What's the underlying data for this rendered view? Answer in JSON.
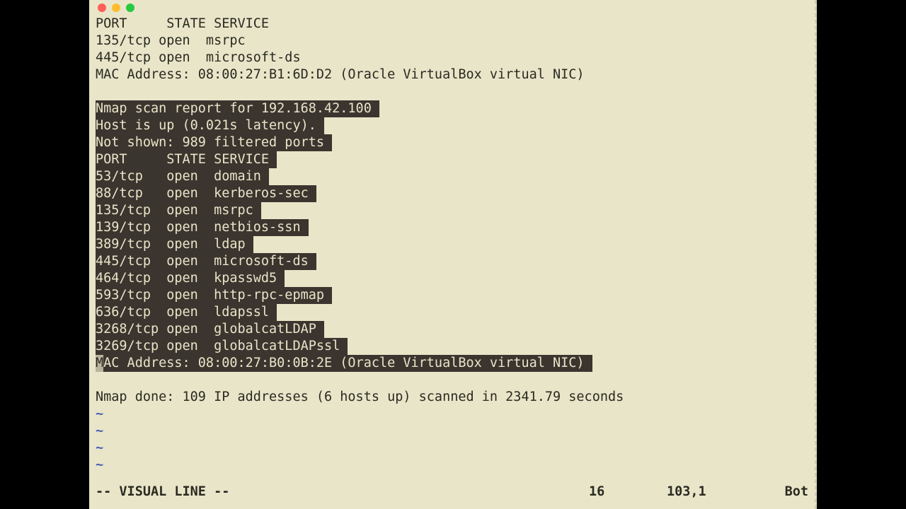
{
  "window": {
    "type": "macos-terminal"
  },
  "unselected_top": [
    "PORT     STATE SERVICE",
    "135/tcp open  msrpc",
    "445/tcp open  microsoft-ds",
    "MAC Address: 08:00:27:B1:6D:D2 (Oracle VirtualBox virtual NIC)",
    ""
  ],
  "selected_block": [
    "Nmap scan report for 192.168.42.100 ",
    "Host is up (0.021s latency). ",
    "Not shown: 989 filtered ports ",
    "PORT     STATE SERVICE ",
    "53/tcp   open  domain ",
    "88/tcp   open  kerberos-sec ",
    "135/tcp  open  msrpc ",
    "139/tcp  open  netbios-ssn ",
    "389/tcp  open  ldap ",
    "445/tcp  open  microsoft-ds ",
    "464/tcp  open  kpasswd5 ",
    "593/tcp  open  http-rpc-epmap ",
    "636/tcp  open  ldapssl ",
    "3268/tcp open  globalcatLDAP ",
    "3269/tcp open  globalcatLDAPssl "
  ],
  "cursor_line": {
    "cursor_char": "M",
    "rest": "AC Address: 08:00:27:B0:0B:2E (Oracle VirtualBox virtual NIC) "
  },
  "unselected_bottom": [
    "",
    "Nmap done: 109 IP addresses (6 hosts up) scanned in 2341.79 seconds"
  ],
  "tilde": "~",
  "tilde_count": 4,
  "status": {
    "mode": "-- VISUAL LINE --",
    "count": "16",
    "position": "103,1",
    "scroll": "Bot"
  }
}
